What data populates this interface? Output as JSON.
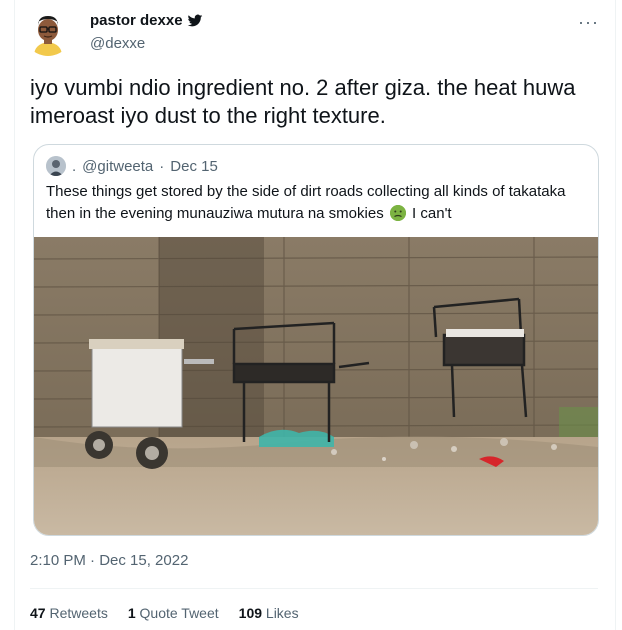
{
  "author": {
    "display_name": "pastor dexxe",
    "handle": "@dexxe",
    "badge_icon": "twitter-bird-icon"
  },
  "tweet": {
    "text": "iyo vumbi ndio ingredient no. 2 after giza. the heat huwa imeroast iyo dust to the right texture."
  },
  "quote_tweet": {
    "author_prefix": ".",
    "handle": "@gitweeta",
    "separator": "·",
    "date": "Dec 15",
    "text_part1": "These things get stored by the side of dirt roads collecting all kinds of takataka then in the evening munauziwa mutura na smokies",
    "emoji": "nauseated-face-icon",
    "text_part2": "I can't"
  },
  "timestamp": "2:10 PM · Dec 15, 2022",
  "stats": {
    "retweets_count": "47",
    "retweets_label": "Retweets",
    "quotes_count": "1",
    "quotes_label": "Quote Tweet",
    "likes_count": "109",
    "likes_label": "Likes"
  },
  "colors": {
    "text_primary": "#0f1419",
    "text_secondary": "#536471",
    "border": "#cfd9de"
  }
}
